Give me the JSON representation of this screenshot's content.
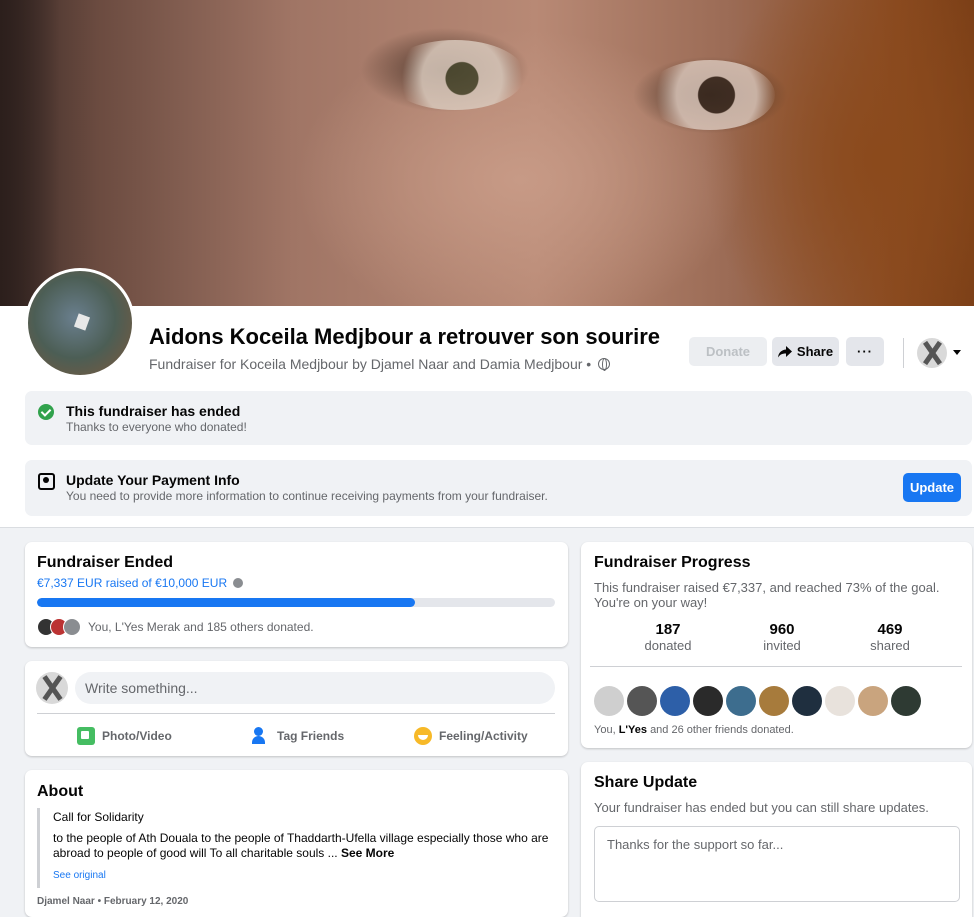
{
  "header": {
    "title": "Aidons Koceila Medjbour a retrouver son sourire",
    "subtitle": "Fundraiser for Koceila Medjbour by Djamel Naar and Damia Medjbour •",
    "donate_label": "Donate",
    "share_label": "Share",
    "more_label": "···"
  },
  "notices": {
    "ended_title": "This fundraiser has ended",
    "ended_sub": "Thanks to everyone who donated!",
    "payment_title": "Update Your Payment Info",
    "payment_sub": "You need to provide more information to continue receiving payments from your fundraiser.",
    "update_label": "Update"
  },
  "ended_card": {
    "title": "Fundraiser Ended",
    "raised": "€7,337 EUR raised of €10,000 EUR",
    "progress_fraction": 0.73,
    "donors_text": "You, L'Yes Merak and 185 others donated."
  },
  "composer": {
    "placeholder": "Write something...",
    "photo_label": "Photo/Video",
    "tag_label": "Tag Friends",
    "feeling_label": "Feeling/Activity"
  },
  "about": {
    "title": "About",
    "line1": "Call for Solidarity",
    "body": "to the people of Ath Douala to the people of Thaddarth-Ufella village especially those who are abroad to people of good will To all charitable souls ...",
    "see_more": "See More",
    "see_original": "See original",
    "meta": "Djamel Naar • February 12, 2020"
  },
  "progress_card": {
    "title": "Fundraiser Progress",
    "desc": "This fundraiser raised €7,337, and reached 73% of the goal. You're on your way!",
    "stats": [
      {
        "num": "187",
        "label": "donated"
      },
      {
        "num": "960",
        "label": "invited"
      },
      {
        "num": "469",
        "label": "shared"
      }
    ],
    "friends_prefix": "You,",
    "friends_name": "L'Yes",
    "friends_suffix": "and 26 other friends donated."
  },
  "share_card": {
    "title": "Share Update",
    "desc": "Your fundraiser has ended but you can still share updates.",
    "placeholder": "Thanks for the support so far..."
  },
  "colors": {
    "accent": "#1877f2",
    "success": "#31a24c"
  }
}
